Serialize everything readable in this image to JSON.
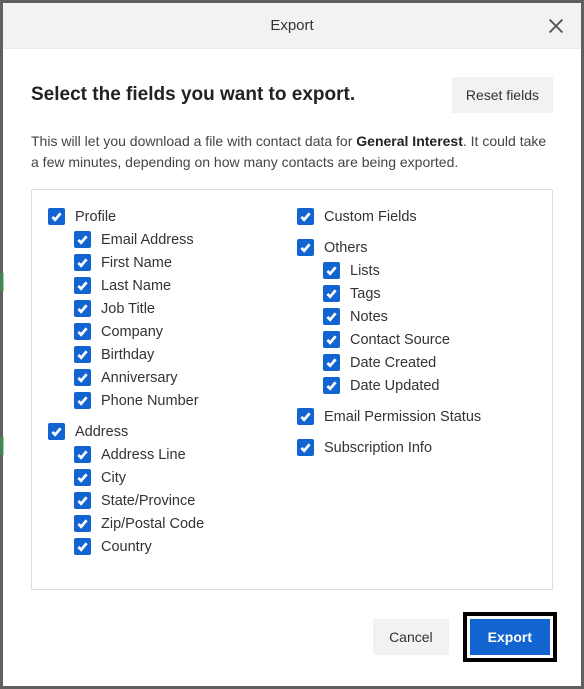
{
  "dialog": {
    "title": "Export",
    "heading": "Select the fields you want to export.",
    "reset_label": "Reset fields",
    "description_pre": "This will let you download a file with contact data for ",
    "description_bold": "General Interest",
    "description_post": ". It could take a few minutes, depending on how many contacts are being exported.",
    "cancel_label": "Cancel",
    "export_label": "Export"
  },
  "left": [
    {
      "group_label": "Profile",
      "items": [
        "Email Address",
        "First Name",
        "Last Name",
        "Job Title",
        "Company",
        "Birthday",
        "Anniversary",
        "Phone Number"
      ]
    },
    {
      "group_label": "Address",
      "items": [
        "Address Line",
        "City",
        "State/Province",
        "Zip/Postal Code",
        "Country"
      ]
    }
  ],
  "right": [
    {
      "group_label": "Custom Fields",
      "items": []
    },
    {
      "group_label": "Others",
      "items": [
        "Lists",
        "Tags",
        "Notes",
        "Contact Source",
        "Date Created",
        "Date Updated"
      ]
    },
    {
      "group_label": "Email Permission Status",
      "items": []
    },
    {
      "group_label": "Subscription Info",
      "items": []
    }
  ]
}
